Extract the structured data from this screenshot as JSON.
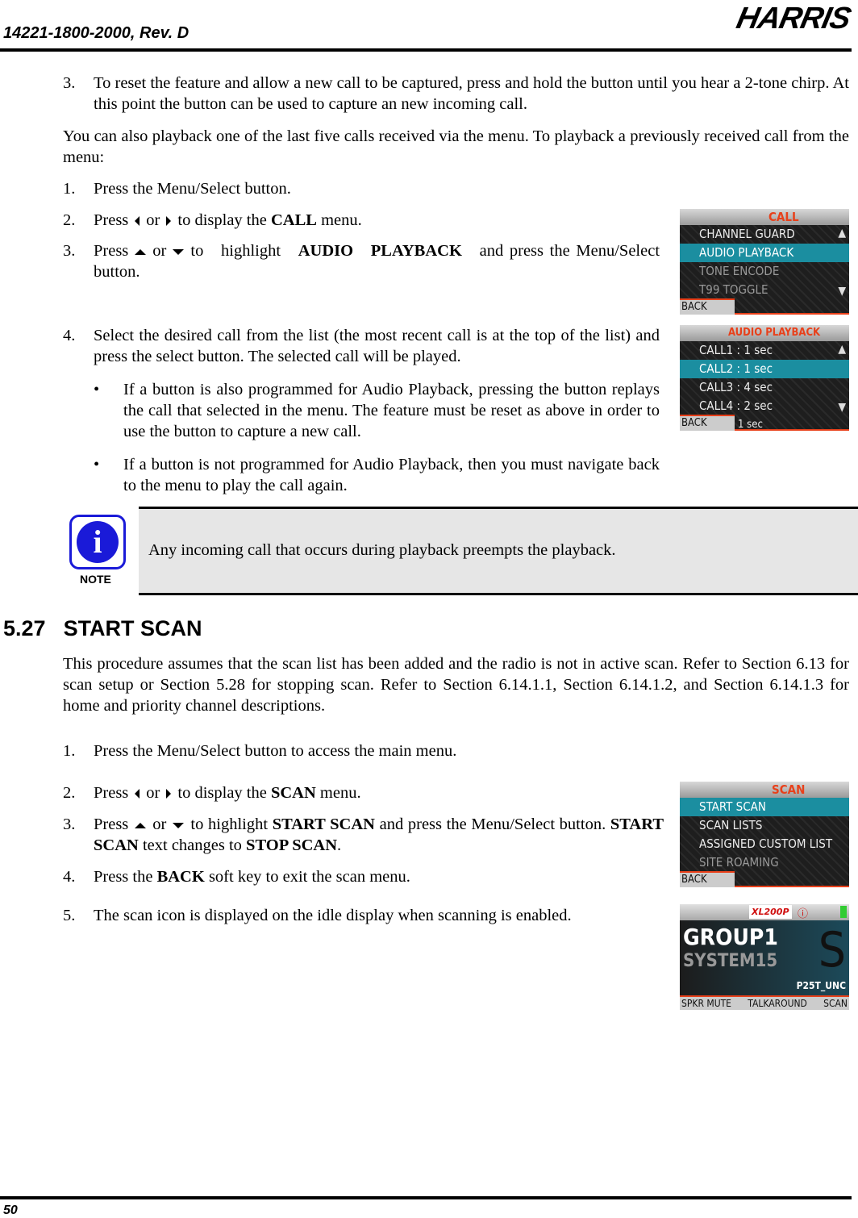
{
  "header": {
    "doc_id": "14221-1800-2000, Rev. D",
    "logo": "HARRIS"
  },
  "top": {
    "step3": {
      "num": "3.",
      "text": "To reset the feature and allow a new call to be captured, press and hold the button until you hear a 2-tone chirp. At this point the button can be used to capture an new incoming call."
    },
    "intro": "You can also playback one of the last five calls received via the menu. To playback a previously received call from the menu:",
    "s1": {
      "num": "1.",
      "text": "Press the Menu/Select button."
    },
    "s2": {
      "num": "2.",
      "a": "Press",
      "or": "or",
      "b": "to display the",
      "bold": "CALL",
      "c": "menu."
    },
    "s3": {
      "num": "3.",
      "a": "Press",
      "or": "or",
      "b": "to highlight",
      "bold": "AUDIO PLAYBACK",
      "c": "and press the Menu/Select button."
    },
    "s4": {
      "num": "4.",
      "text": "Select the desired call from the list (the most recent call is at the top of the list) and press the select button. The selected call will be played."
    },
    "b1": "If a button is also programmed for Audio Playback, pressing the button replays the call that selected in the menu. The feature must be reset as above in order to use the button to capture a new call.",
    "b2": "If a button is not programmed for Audio Playback, then you must navigate back to the menu to play the call again."
  },
  "note": {
    "label": "NOTE",
    "text": "Any incoming call that occurs during playback preempts the playback."
  },
  "section": {
    "number": "5.27",
    "title": "START SCAN",
    "intro": "This procedure assumes that the scan list has been added and the radio is not in active scan. Refer to Section 6.13 for scan setup or Section 5.28 for stopping scan. Refer to Section 6.14.1.1, Section 6.14.1.2, and Section 6.14.1.3 for home and priority channel descriptions.",
    "s1": {
      "num": "1.",
      "text": "Press the Menu/Select button to access the main menu."
    },
    "s2": {
      "num": "2.",
      "a": "Press",
      "or": "or",
      "b": "to display the",
      "bold": "SCAN",
      "c": "menu."
    },
    "s3": {
      "num": "3.",
      "a": "Press",
      "or": "or",
      "b": "to highlight",
      "bold": "START SCAN",
      "c": "and press the Menu/Select button.",
      "bold2": "START SCAN",
      "d": "text changes to",
      "bold3": "STOP SCAN",
      "e": "."
    },
    "s4": {
      "num": "4.",
      "a": "Press the",
      "bold": "BACK",
      "b": "soft key to exit the scan menu."
    },
    "s5": {
      "num": "5.",
      "text": "The scan icon is displayed on the idle display when scanning is enabled."
    }
  },
  "screens": {
    "call": {
      "title": "CALL",
      "items": [
        "CHANNEL GUARD",
        "AUDIO PLAYBACK",
        "TONE ENCODE",
        "T99 TOGGLE"
      ],
      "selected": "AUDIO PLAYBACK",
      "back": "BACK"
    },
    "playback": {
      "title": "AUDIO PLAYBACK",
      "items": [
        "CALL1 : 1 sec",
        "CALL2 : 1 sec",
        "CALL3 : 4 sec",
        "CALL4 : 2 sec"
      ],
      "partial": "1 sec",
      "selected": "CALL2 : 1 sec",
      "back": "BACK"
    },
    "scan": {
      "title": "SCAN",
      "items": [
        "START SCAN",
        "SCAN LISTS",
        "ASSIGNED CUSTOM LIST",
        "SITE ROAMING"
      ],
      "selected": "START SCAN",
      "back": "BACK"
    },
    "idle": {
      "badge": "XL200P",
      "line1": "GROUP1",
      "line2": "SYSTEM15",
      "channel": "P25T_UNC",
      "soft": [
        "SPKR MUTE",
        "TALKAROUND",
        "SCAN"
      ]
    }
  },
  "footer": {
    "page": "50"
  },
  "colors": {
    "highlight": "#1b8ea0",
    "title": "#e8401a",
    "note_bg": "#e6e6e6",
    "note_icon": "#1a1ad8"
  }
}
